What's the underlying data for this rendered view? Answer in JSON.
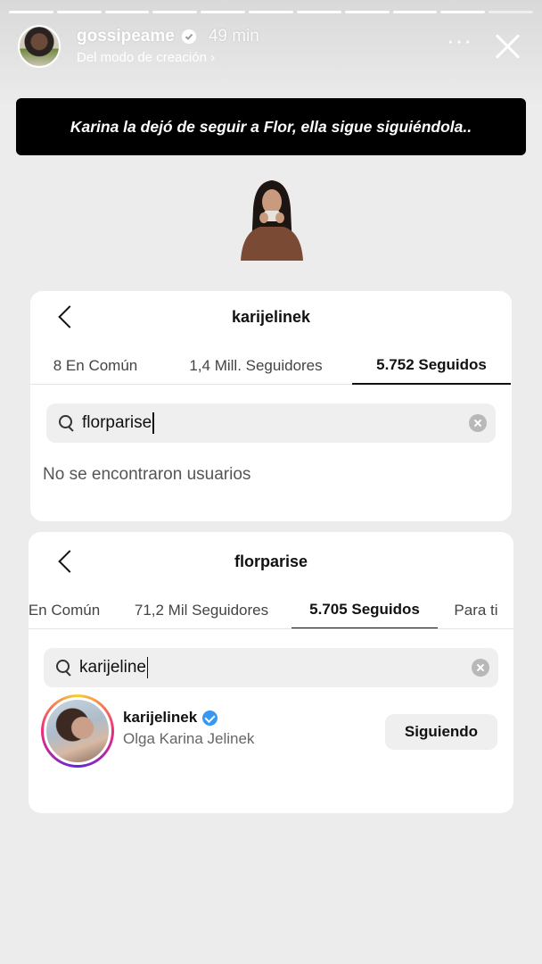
{
  "story": {
    "username": "gossipeame",
    "time": "49 min",
    "subtitle": "Del modo de creación",
    "subtitle_chevron": "›",
    "more_icon": "more-horizontal-icon",
    "close_icon": "close-icon",
    "progress": {
      "segments": 11,
      "completed": 10
    }
  },
  "caption": "Karina la dejó de seguir a Flor, ella sigue siguiéndola..",
  "card1": {
    "title": "karijelinek",
    "tabs": [
      "8 En Común",
      "1,4 Mill. Seguidores",
      "5.752 Seguidos"
    ],
    "active_tab": 2,
    "search_value": "florparise",
    "empty_message": "No se encontraron usuarios"
  },
  "card2": {
    "title": "florparise",
    "tabs": [
      "En Común",
      "71,2 Mil Seguidores",
      "5.705 Seguidos",
      "Para ti"
    ],
    "active_tab": 2,
    "search_value": "karijeline",
    "result": {
      "username": "karijelinek",
      "full_name": "Olga Karina Jelinek",
      "verified": true,
      "button": "Siguiendo"
    }
  },
  "colors": {
    "verified": "#3897f0",
    "caption_bg": "#000000",
    "card_bg": "#ffffff"
  }
}
